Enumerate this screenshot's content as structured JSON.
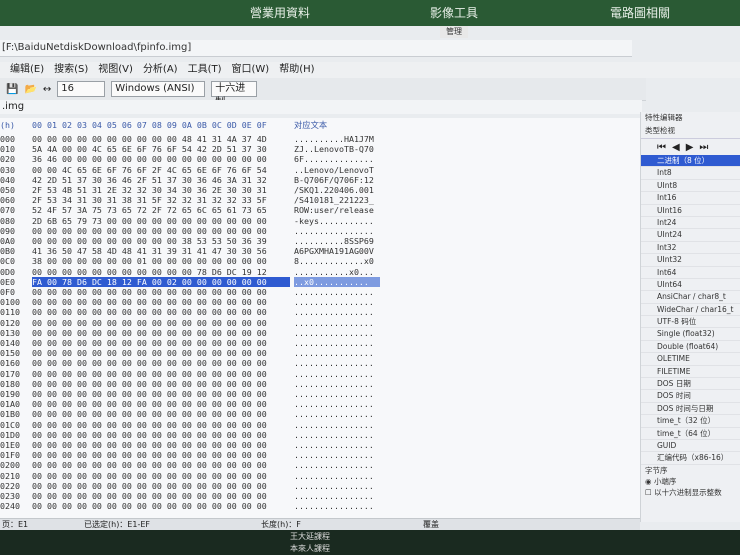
{
  "taskbar_top": {
    "item1": "營業用資料",
    "item2": "影像工具",
    "item3": "電路圖相關",
    "small_tab": "管理"
  },
  "title": {
    "path": "[F:\\BaiduNetdiskDownload\\fpinfo.img]"
  },
  "menu": [
    "编辑(E)",
    "搜索(S)",
    "视图(V)",
    "分析(A)",
    "工具(T)",
    "窗口(W)",
    "帮助(H)"
  ],
  "toolbar": {
    "bytes_per_row": "16",
    "encoding": "Windows (ANSI)",
    "base": "十六进制"
  },
  "file_tab": ".img",
  "hex_header": {
    "offset": "(h)",
    "columns": [
      "00",
      "01",
      "02",
      "03",
      "04",
      "05",
      "06",
      "07",
      "08",
      "09",
      "0A",
      "0B",
      "0C",
      "0D",
      "0E",
      "0F"
    ],
    "text_title": "对应文本"
  },
  "rows": [
    {
      "addr": "000",
      "hex": "00 00 00 00 00 00 00 00 00 00 48 41 31 4A 37 4D",
      "ascii": "..........HA1J7M"
    },
    {
      "addr": "010",
      "hex": "5A 4A 00 00 4C 65 6E 6F 76 6F 54 42 2D 51 37 30",
      "ascii": "ZJ..LenovoTB-Q70"
    },
    {
      "addr": "020",
      "hex": "36 46 00 00 00 00 00 00 00 00 00 00 00 00 00 00",
      "ascii": "6F.............."
    },
    {
      "addr": "030",
      "hex": "00 00 4C 65 6E 6F 76 6F 2F 4C 65 6E 6F 76 6F 54",
      "ascii": "..Lenovo/LenovoT"
    },
    {
      "addr": "040",
      "hex": "42 2D 51 37 30 36 46 2F 51 37 30 36 46 3A 31 32",
      "ascii": "B-Q706F/Q706F:12"
    },
    {
      "addr": "050",
      "hex": "2F 53 4B 51 31 2E 32 32 30 34 30 36 2E 30 30 31",
      "ascii": "/SKQ1.220406.001"
    },
    {
      "addr": "060",
      "hex": "2F 53 34 31 30 31 38 31 5F 32 32 31 32 32 33 5F",
      "ascii": "/S410181_221223_"
    },
    {
      "addr": "070",
      "hex": "52 4F 57 3A 75 73 65 72 2F 72 65 6C 65 61 73 65",
      "ascii": "ROW:user/release"
    },
    {
      "addr": "080",
      "hex": "2D 6B 65 79 73 00 00 00 00 00 00 00 00 00 00 00",
      "ascii": "-keys..........."
    },
    {
      "addr": "090",
      "hex": "00 00 00 00 00 00 00 00 00 00 00 00 00 00 00 00",
      "ascii": "................"
    },
    {
      "addr": "0A0",
      "hex": "00 00 00 00 00 00 00 00 00 00 38 53 53 50 36 39",
      "ascii": "..........8SSP69"
    },
    {
      "addr": "0B0",
      "hex": "41 36 50 47 58 4D 48 41 31 39 31 41 47 30 30 56",
      "ascii": "A6PGXMHA191AG00V"
    },
    {
      "addr": "0C0",
      "hex": "38 00 00 00 00 00 00 01 00 00 00 00 00 00 00 00",
      "ascii": "8.............x0"
    },
    {
      "addr": "0D0",
      "hex": "00 00 00 00 00 00 00 00 00 00 00 78 D6 DC 19 12",
      "ascii": "...........x0..."
    },
    {
      "addr": "0E0",
      "hex": "FA 00 78 D6 DC 18 12 FA 00 02 00 00 00 00 00 00",
      "ascii": "..x0...........",
      "selected": true
    },
    {
      "addr": "0F0",
      "hex": "00 00 00 00 00 00 00 00 00 00 00 00 00 00 00 00",
      "ascii": "................"
    },
    {
      "addr": "0100",
      "hex": "00 00 00 00 00 00 00 00 00 00 00 00 00 00 00 00",
      "ascii": "................"
    },
    {
      "addr": "0110",
      "hex": "00 00 00 00 00 00 00 00 00 00 00 00 00 00 00 00",
      "ascii": "................"
    },
    {
      "addr": "0120",
      "hex": "00 00 00 00 00 00 00 00 00 00 00 00 00 00 00 00",
      "ascii": "................"
    },
    {
      "addr": "0130",
      "hex": "00 00 00 00 00 00 00 00 00 00 00 00 00 00 00 00",
      "ascii": "................"
    },
    {
      "addr": "0140",
      "hex": "00 00 00 00 00 00 00 00 00 00 00 00 00 00 00 00",
      "ascii": "................"
    },
    {
      "addr": "0150",
      "hex": "00 00 00 00 00 00 00 00 00 00 00 00 00 00 00 00",
      "ascii": "................"
    },
    {
      "addr": "0160",
      "hex": "00 00 00 00 00 00 00 00 00 00 00 00 00 00 00 00",
      "ascii": "................"
    },
    {
      "addr": "0170",
      "hex": "00 00 00 00 00 00 00 00 00 00 00 00 00 00 00 00",
      "ascii": "................"
    },
    {
      "addr": "0180",
      "hex": "00 00 00 00 00 00 00 00 00 00 00 00 00 00 00 00",
      "ascii": "................"
    },
    {
      "addr": "0190",
      "hex": "00 00 00 00 00 00 00 00 00 00 00 00 00 00 00 00",
      "ascii": "................"
    },
    {
      "addr": "01A0",
      "hex": "00 00 00 00 00 00 00 00 00 00 00 00 00 00 00 00",
      "ascii": "................"
    },
    {
      "addr": "01B0",
      "hex": "00 00 00 00 00 00 00 00 00 00 00 00 00 00 00 00",
      "ascii": "................"
    },
    {
      "addr": "01C0",
      "hex": "00 00 00 00 00 00 00 00 00 00 00 00 00 00 00 00",
      "ascii": "................"
    },
    {
      "addr": "01D0",
      "hex": "00 00 00 00 00 00 00 00 00 00 00 00 00 00 00 00",
      "ascii": "................"
    },
    {
      "addr": "01E0",
      "hex": "00 00 00 00 00 00 00 00 00 00 00 00 00 00 00 00",
      "ascii": "................"
    },
    {
      "addr": "01F0",
      "hex": "00 00 00 00 00 00 00 00 00 00 00 00 00 00 00 00",
      "ascii": "................"
    },
    {
      "addr": "0200",
      "hex": "00 00 00 00 00 00 00 00 00 00 00 00 00 00 00 00",
      "ascii": "................"
    },
    {
      "addr": "0210",
      "hex": "00 00 00 00 00 00 00 00 00 00 00 00 00 00 00 00",
      "ascii": "................"
    },
    {
      "addr": "0220",
      "hex": "00 00 00 00 00 00 00 00 00 00 00 00 00 00 00 00",
      "ascii": "................"
    },
    {
      "addr": "0230",
      "hex": "00 00 00 00 00 00 00 00 00 00 00 00 00 00 00 00",
      "ascii": "................"
    },
    {
      "addr": "0240",
      "hex": "00 00 00 00 00 00 00 00 00 00 00 00 00 00 00 00",
      "ascii": "................"
    }
  ],
  "side_panel": {
    "title": "特性编辑器",
    "tab": "类型检视",
    "types": [
      "二进制（8 位）",
      "Int8",
      "UInt8",
      "Int16",
      "UInt16",
      "Int24",
      "UInt24",
      "Int32",
      "UInt32",
      "Int64",
      "UInt64",
      "AnsiChar / char8_t",
      "WideChar / char16_t",
      "UTF-8 码位",
      "Single (float32)",
      "Double (float64)",
      "OLETIME",
      "FILETIME",
      "DOS 日期",
      "DOS 时间",
      "DOS 时间与日期",
      "time_t（32 位）",
      "time_t（64 位）",
      "GUID",
      "汇编代码（x86-16）"
    ],
    "byte_order_label": "字节序",
    "little_endian": "小端序",
    "hex_option": "以十六进制显示整数"
  },
  "status": {
    "page": "页：E1",
    "selected": "已选定(h)：E1-EF",
    "length": "长度(h)：F",
    "overwrite": "覆盖"
  },
  "bottom_files": [
    "王大延課程",
    "本來人課程"
  ]
}
